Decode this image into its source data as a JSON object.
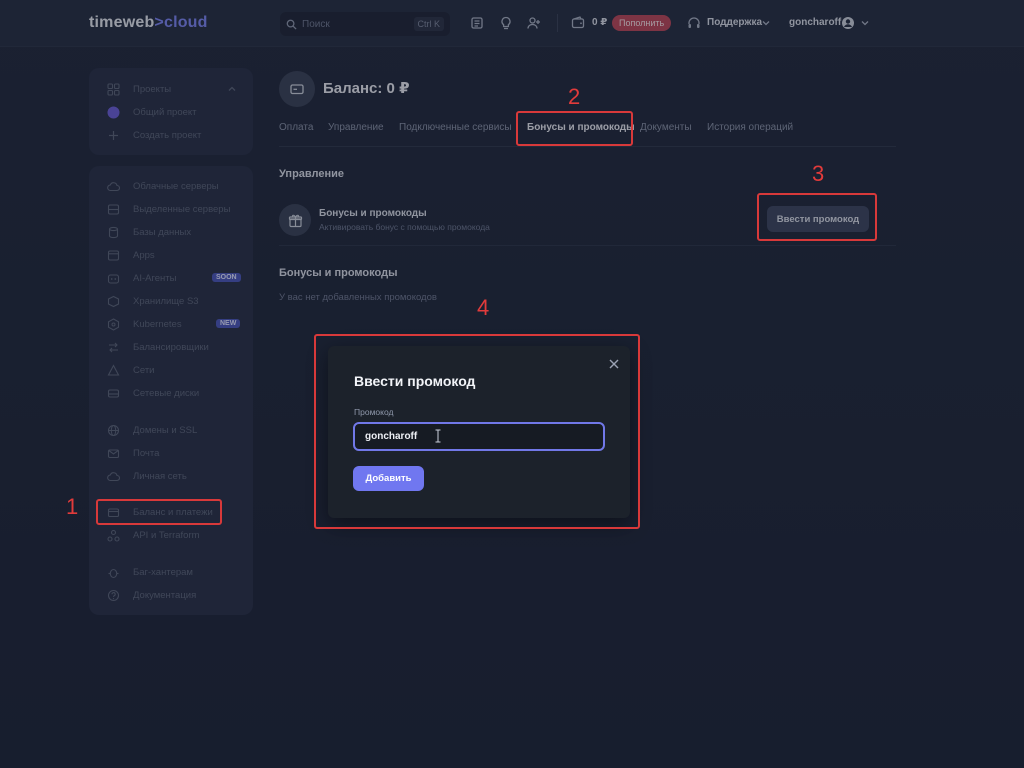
{
  "brand": {
    "name_part1": "timeweb",
    "name_sep": ">",
    "name_part2": "cloud"
  },
  "topbar": {
    "search_placeholder": "Поиск",
    "search_shortcut": "Ctrl K",
    "balance": "0 ₽",
    "topup_label": "Пополнить",
    "support_label": "Поддержка",
    "username": "goncharoff"
  },
  "sidebar": {
    "projects_header": "Проекты",
    "projects": [
      {
        "label": "Общий проект",
        "icon": "project-avatar-icon"
      },
      {
        "label": "Создать проект",
        "icon": "plus-icon"
      }
    ],
    "services": [
      {
        "label": "Облачные серверы",
        "icon": "cloud-icon"
      },
      {
        "label": "Выделенные серверы",
        "icon": "server-icon"
      },
      {
        "label": "Базы данных",
        "icon": "database-icon"
      },
      {
        "label": "Apps",
        "icon": "apps-icon"
      },
      {
        "label": "AI-Агенты",
        "icon": "ai-icon",
        "badge": "SOON"
      },
      {
        "label": "Хранилище S3",
        "icon": "storage-icon"
      },
      {
        "label": "Kubernetes",
        "icon": "kubernetes-icon",
        "badge": "NEW"
      },
      {
        "label": "Балансировщики",
        "icon": "balancer-icon"
      },
      {
        "label": "Сети",
        "icon": "network-icon"
      },
      {
        "label": "Сетевые диски",
        "icon": "disk-icon"
      },
      {
        "label": "Домены и SSL",
        "icon": "globe-icon"
      },
      {
        "label": "Почта",
        "icon": "mail-icon"
      },
      {
        "label": "Личная сеть",
        "icon": "private-network-icon"
      },
      {
        "label": "Баланс и платежи",
        "icon": "wallet-icon"
      },
      {
        "label": "API и Terraform",
        "icon": "api-icon"
      },
      {
        "label": "Баг-хантерам",
        "icon": "bug-icon"
      },
      {
        "label": "Документация",
        "icon": "help-icon"
      }
    ]
  },
  "main": {
    "title": "Баланс: 0 ₽",
    "tabs": [
      "Оплата",
      "Управление",
      "Подключенные сервисы",
      "Бонусы и промокоды",
      "Документы",
      "История операций"
    ],
    "active_tab": "Бонусы и промокоды",
    "management": {
      "heading": "Управление",
      "row_title": "Бонусы и промокоды",
      "row_subtitle": "Активировать бонус с помощью промокода",
      "button": "Ввести промокод"
    },
    "promos": {
      "heading": "Бонусы и промокоды",
      "empty": "У вас нет добавленных промокодов"
    }
  },
  "modal": {
    "title": "Ввести промокод",
    "field_label": "Промокод",
    "field_value": "goncharoff",
    "submit": "Добавить"
  },
  "annotations": [
    "1",
    "2",
    "3",
    "4"
  ],
  "colors": {
    "accent": "#7077f0",
    "highlight": "#d8393a",
    "topup": "#b9475a",
    "background": "#222a3d"
  }
}
